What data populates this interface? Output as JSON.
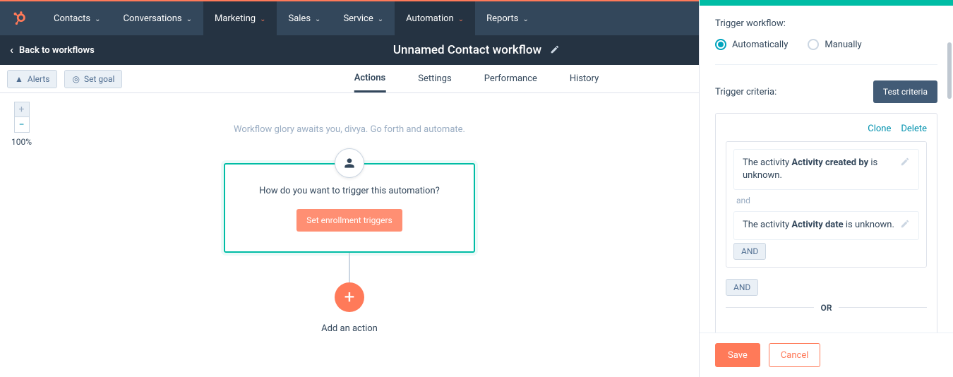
{
  "nav": {
    "items": [
      {
        "label": "Contacts"
      },
      {
        "label": "Conversations"
      },
      {
        "label": "Marketing",
        "active": true
      },
      {
        "label": "Sales"
      },
      {
        "label": "Service"
      },
      {
        "label": "Automation",
        "active": true
      },
      {
        "label": "Reports"
      }
    ]
  },
  "sub": {
    "back": "Back to workflows",
    "title": "Unnamed Contact workflow"
  },
  "toolbar": {
    "alerts": "Alerts",
    "setgoal": "Set goal"
  },
  "tabs": [
    "Actions",
    "Settings",
    "Performance",
    "History"
  ],
  "tab_active": 0,
  "zoom": {
    "level": "100%"
  },
  "hint": "Workflow glory awaits you, divya. Go forth and automate.",
  "trigger_card": {
    "question": "How do you want to trigger this automation?",
    "cta": "Set enrollment triggers"
  },
  "add_action": "Add an action",
  "panel": {
    "trigger_label": "Trigger workflow:",
    "options": {
      "auto": "Automatically",
      "manual": "Manually",
      "selected": "auto"
    },
    "criteria_label": "Trigger criteria:",
    "test_btn": "Test criteria",
    "links": {
      "clone": "Clone",
      "delete": "Delete"
    },
    "conditions": [
      {
        "pre": "The activity ",
        "field": "Activity created by",
        "post": " is unknown."
      },
      {
        "pre": "The activity ",
        "field": "Activity date",
        "post": " is unknown."
      }
    ],
    "and_join": "and",
    "and_btn": "AND",
    "or": "OR",
    "save": "Save",
    "cancel": "Cancel"
  }
}
